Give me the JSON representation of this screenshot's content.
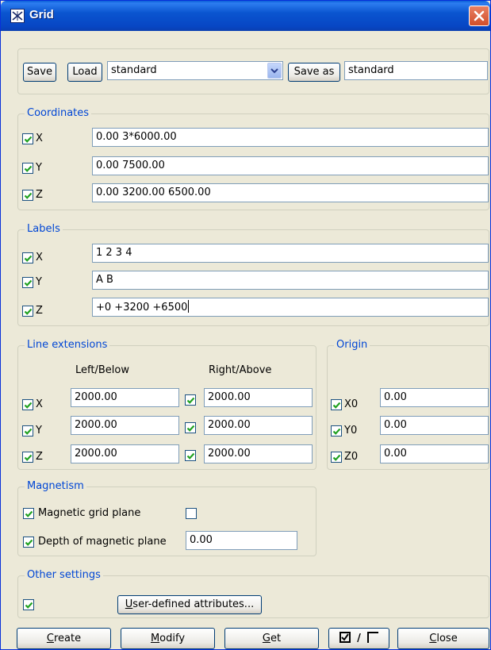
{
  "window": {
    "title": "Grid",
    "icon": "grid-app-icon",
    "close_icon": "close-icon"
  },
  "toolbar": {
    "save_label": "Save",
    "load_label": "Load",
    "preset_selected": "standard",
    "save_as_label": "Save as",
    "save_as_value": "standard"
  },
  "coordinates": {
    "legend": "Coordinates",
    "rows": [
      {
        "label": "X",
        "checked": true,
        "value": "0.00 3*6000.00"
      },
      {
        "label": "Y",
        "checked": true,
        "value": "0.00 7500.00"
      },
      {
        "label": "Z",
        "checked": true,
        "value": "0.00 3200.00 6500.00"
      }
    ]
  },
  "labels": {
    "legend": "Labels",
    "rows": [
      {
        "label": "X",
        "checked": true,
        "value": "1 2 3 4"
      },
      {
        "label": "Y",
        "checked": true,
        "value": "A B"
      },
      {
        "label": "Z",
        "checked": true,
        "value": "+0 +3200 +6500"
      }
    ]
  },
  "line_extensions": {
    "legend": "Line extensions",
    "col_left": "Left/Below",
    "col_right": "Right/Above",
    "rows": [
      {
        "label": "X",
        "left": "2000.00",
        "right": "2000.00"
      },
      {
        "label": "Y",
        "left": "2000.00",
        "right": "2000.00"
      },
      {
        "label": "Z",
        "left": "2000.00",
        "right": "2000.00"
      }
    ]
  },
  "origin": {
    "legend": "Origin",
    "rows": [
      {
        "label": "X0",
        "value": "0.00"
      },
      {
        "label": "Y0",
        "value": "0.00"
      },
      {
        "label": "Z0",
        "value": "0.00"
      }
    ]
  },
  "magnetism": {
    "legend": "Magnetism",
    "grid_plane_label": "Magnetic grid plane",
    "depth_label": "Depth of magnetic plane",
    "depth_value": "0.00"
  },
  "other": {
    "legend": "Other settings",
    "uda_first": "U",
    "uda_rest": "ser-defined attributes..."
  },
  "bottom": {
    "create_first": "C",
    "create_rest": "reate",
    "modify_first": "M",
    "modify_rest": "odify",
    "get_first": "G",
    "get_rest": "et",
    "toggle_sep": "/",
    "close_first": "C",
    "close_rest": "lose"
  },
  "colors": {
    "title_blue": "#0a55d0",
    "legend_blue": "#0046d5",
    "check_green": "#21a121",
    "dialog_bg": "#ece9d8"
  }
}
